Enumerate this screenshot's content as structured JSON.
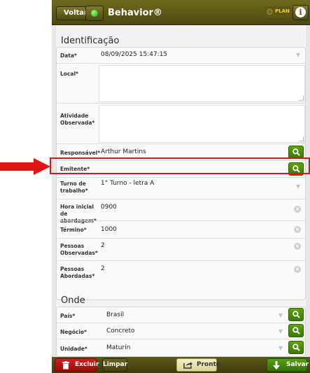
{
  "header": {
    "back_label": "Voltar",
    "title": "Behavior®",
    "plan_text": "PLAN",
    "info_symbol": "i"
  },
  "identificacao": {
    "section_title": "Identificação",
    "data": {
      "label": "Data*",
      "value": "08/09/2025 15:47:15"
    },
    "local": {
      "label": "Local*",
      "value": ""
    },
    "atividade": {
      "label": "Atividade Observada*",
      "value": ""
    },
    "responsavel": {
      "label": "Responsável*",
      "value": "Arthur Martins"
    },
    "emitente": {
      "label": "Emitente*",
      "value": ""
    },
    "turno": {
      "label": "Turno de trabalho*",
      "value": "1° Turno - letra A"
    },
    "hora_inicial": {
      "label": "Hora inicial de abordagem*",
      "value": "0900"
    },
    "termino": {
      "label": "Término*",
      "value": "1000"
    },
    "pessoas_observadas": {
      "label": "Pessoas Observadas*",
      "value": "2"
    },
    "pessoas_abordadas": {
      "label": "Pessoas Abordadas*",
      "value": "2"
    }
  },
  "onde": {
    "section_title": "Onde",
    "pais": {
      "label": "País*",
      "value": "Brasil"
    },
    "negocio": {
      "label": "Negócio*",
      "value": "Concreto"
    },
    "unidade": {
      "label": "Unidade*",
      "value": "Maturín"
    }
  },
  "footer": {
    "excluir": "Excluir",
    "limpar": "Limpar",
    "pronto": "Pronto",
    "salvar": "Salvar"
  },
  "colors": {
    "header": "#5c5814",
    "accent_green": "#4a8e0a",
    "delete_red": "#c11414",
    "highlight": "#e01414"
  }
}
